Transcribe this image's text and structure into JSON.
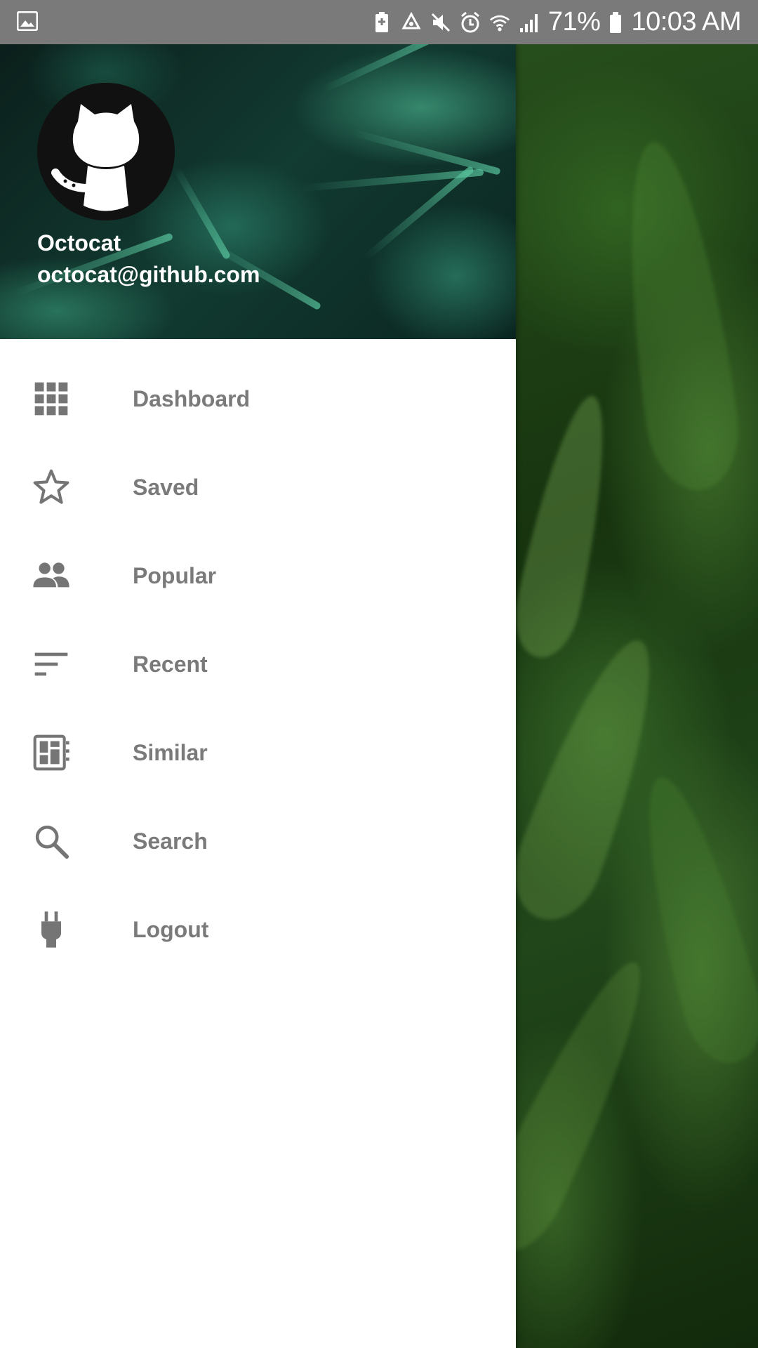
{
  "status_bar": {
    "battery_percent": "71%",
    "time": "10:03 AM",
    "left_icon": "gallery-icon",
    "right_icons": [
      "battery-saver-icon",
      "recycle-icon",
      "mute-icon",
      "alarm-icon",
      "wifi-icon",
      "signal-icon",
      "battery-icon"
    ]
  },
  "drawer": {
    "header": {
      "avatar_icon": "octocat-avatar",
      "name": "Octocat",
      "email": "octocat@github.com"
    },
    "items": [
      {
        "label": "Dashboard",
        "icon": "grid-icon"
      },
      {
        "label": "Saved",
        "icon": "star-icon"
      },
      {
        "label": "Popular",
        "icon": "people-icon"
      },
      {
        "label": "Recent",
        "icon": "sort-icon"
      },
      {
        "label": "Similar",
        "icon": "dashboard-panel-icon"
      },
      {
        "label": "Search",
        "icon": "search-icon"
      },
      {
        "label": "Logout",
        "icon": "plug-icon"
      }
    ]
  },
  "colors": {
    "status_bar": "#7a7a7a",
    "menu_text": "#7a7a7a",
    "menu_icon": "#757575",
    "drawer_bg": "#ffffff"
  }
}
